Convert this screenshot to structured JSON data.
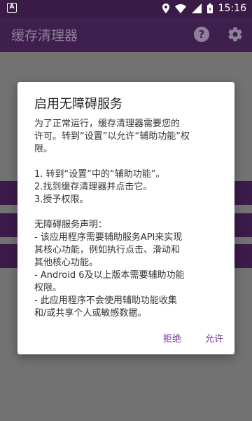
{
  "status_bar": {
    "time": "15:16"
  },
  "app_bar": {
    "title": "缓存清理器",
    "help_label": "?"
  },
  "dialog": {
    "title": "启用无障碍服务",
    "intro_lines": [
      "为了正常运行，缓存清理器需要您的",
      "许可。转到“设置”以允许“辅助功能”权",
      "限。"
    ],
    "steps": [
      " 1. 转到“设置”中的“辅助功能”。",
      " 2.找到缓存清理器并点击它。",
      " 3.授予权限。"
    ],
    "notice_lines": [
      " 无障碍服务声明：",
      " - 该应用程序需要辅助服务API来实现",
      " 其核心功能，例如执行点击、滑动和",
      " 其他核心功能。",
      " - Android 6及以上版本需要辅助功能",
      " 权限。",
      " - 此应用程序不会使用辅助功能收集",
      " 和/或共享个人或敏感数据。"
    ],
    "deny_label": "拒绝",
    "allow_label": "允许"
  },
  "colors": {
    "app_bar": "#3e1f4d",
    "accent": "#7b2d95",
    "scrim": "#727272"
  }
}
